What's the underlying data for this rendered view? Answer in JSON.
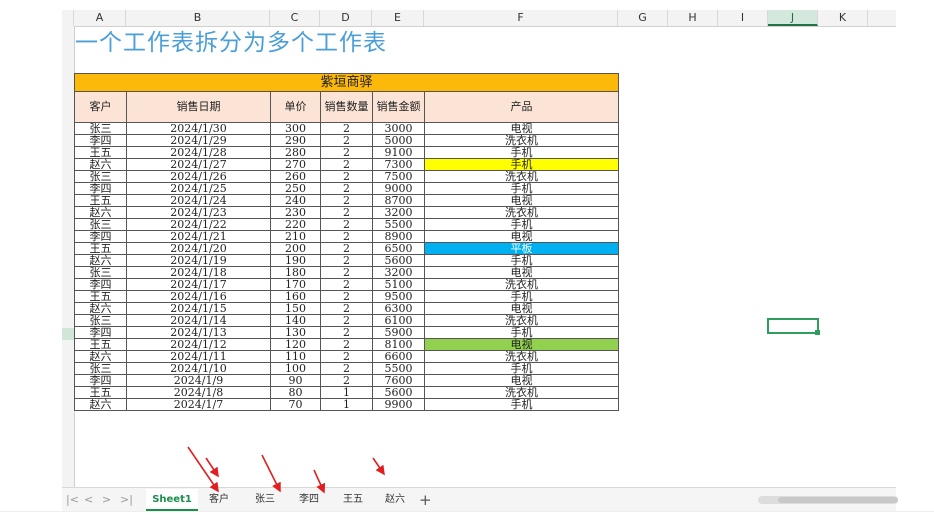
{
  "columns": [
    "A",
    "B",
    "C",
    "D",
    "E",
    "F",
    "G",
    "H",
    "I",
    "J",
    "K"
  ],
  "selected_column": "J",
  "row_numbers": [
    "",
    "",
    "",
    "",
    "",
    "",
    "",
    "",
    "",
    "",
    "",
    "",
    "",
    "",
    "",
    "",
    "",
    "",
    "",
    "",
    "",
    "",
    "",
    "",
    "",
    "",
    "",
    "",
    "",
    "",
    "",
    "",
    "",
    "",
    "",
    "",
    "",
    ""
  ],
  "title": "一个工作表拆分为多个工作表",
  "table": {
    "band": "紫垣商驿",
    "headers": [
      "客户",
      "销售日期",
      "单价",
      "销售数量",
      "销售金额",
      "产品"
    ],
    "rows": [
      [
        "张三",
        "2024/1/30",
        "300",
        "2",
        "3000",
        "电视"
      ],
      [
        "李四",
        "2024/1/29",
        "290",
        "2",
        "5000",
        "洗衣机"
      ],
      [
        "王五",
        "2024/1/28",
        "280",
        "2",
        "9100",
        "手机"
      ],
      [
        "赵六",
        "2024/1/27",
        "270",
        "2",
        "7300",
        "手机"
      ],
      [
        "张三",
        "2024/1/26",
        "260",
        "2",
        "7500",
        "洗衣机"
      ],
      [
        "李四",
        "2024/1/25",
        "250",
        "2",
        "9000",
        "手机"
      ],
      [
        "王五",
        "2024/1/24",
        "240",
        "2",
        "8700",
        "电视"
      ],
      [
        "赵六",
        "2024/1/23",
        "230",
        "2",
        "3200",
        "洗衣机"
      ],
      [
        "张三",
        "2024/1/22",
        "220",
        "2",
        "5500",
        "手机"
      ],
      [
        "李四",
        "2024/1/21",
        "210",
        "2",
        "8900",
        "电视"
      ],
      [
        "王五",
        "2024/1/20",
        "200",
        "2",
        "6500",
        "平板"
      ],
      [
        "赵六",
        "2024/1/19",
        "190",
        "2",
        "5600",
        "手机"
      ],
      [
        "张三",
        "2024/1/18",
        "180",
        "2",
        "3200",
        "电视"
      ],
      [
        "李四",
        "2024/1/17",
        "170",
        "2",
        "5100",
        "洗衣机"
      ],
      [
        "王五",
        "2024/1/16",
        "160",
        "2",
        "9500",
        "手机"
      ],
      [
        "赵六",
        "2024/1/15",
        "150",
        "2",
        "6300",
        "电视"
      ],
      [
        "张三",
        "2024/1/14",
        "140",
        "2",
        "6100",
        "洗衣机"
      ],
      [
        "李四",
        "2024/1/13",
        "130",
        "2",
        "5900",
        "手机"
      ],
      [
        "王五",
        "2024/1/12",
        "120",
        "2",
        "8100",
        "电视"
      ],
      [
        "赵六",
        "2024/1/11",
        "110",
        "2",
        "6600",
        "洗衣机"
      ],
      [
        "张三",
        "2024/1/10",
        "100",
        "2",
        "5500",
        "手机"
      ],
      [
        "李四",
        "2024/1/9",
        "90",
        "2",
        "7600",
        "电视"
      ],
      [
        "王五",
        "2024/1/8",
        "80",
        "1",
        "5600",
        "洗衣机"
      ],
      [
        "赵六",
        "2024/1/7",
        "70",
        "1",
        "9900",
        "手机"
      ]
    ],
    "highlights": {
      "3": "yellow",
      "10": "blue",
      "18": "green"
    }
  },
  "tabs": [
    "Sheet1",
    "客户",
    "张三",
    "李四",
    "王五",
    "赵六"
  ],
  "active_tab": "Sheet1",
  "add_tab_label": "+",
  "nav": {
    "first": "|<",
    "prev": "<",
    "next": ">",
    "last": ">|"
  },
  "colors": {
    "accent": "#1a8f4c",
    "title": "#4b9fd8",
    "band": "#fdb90a",
    "header": "#fbe4d6",
    "arrow": "#e02020"
  }
}
